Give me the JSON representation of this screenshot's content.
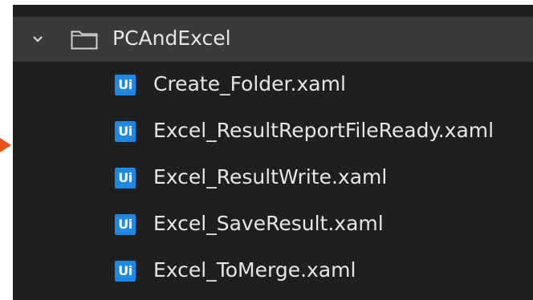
{
  "colors": {
    "panel_bg": "#1f1f1f",
    "selected_row_bg": "#3a3a3a",
    "text": "#e6e6e6",
    "ui_badge": "#1e88e5",
    "arrow": "#e8501e"
  },
  "icons": {
    "expand": "chevron-down-icon",
    "folder": "folder-icon",
    "file": "uipath-workflow-icon"
  },
  "tree": {
    "folder": {
      "label": "PCAndExcel",
      "expanded": true
    },
    "files": [
      {
        "badge": "Ui",
        "label": "Create_Folder.xaml"
      },
      {
        "badge": "Ui",
        "label": "Excel_ResultReportFileReady.xaml"
      },
      {
        "badge": "Ui",
        "label": "Excel_ResultWrite.xaml"
      },
      {
        "badge": "Ui",
        "label": "Excel_SaveResult.xaml"
      },
      {
        "badge": "Ui",
        "label": "Excel_ToMerge.xaml"
      }
    ]
  }
}
